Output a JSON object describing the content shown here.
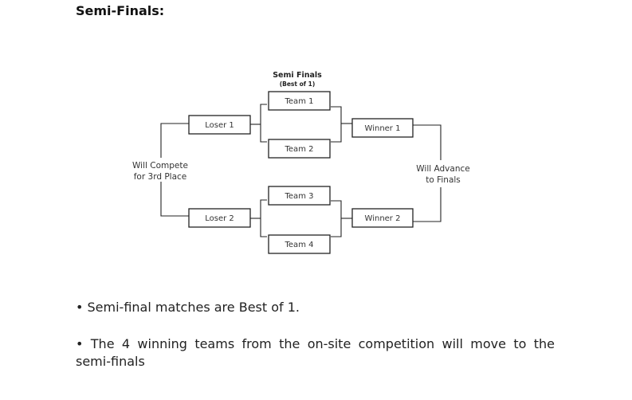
{
  "section": {
    "heading": "Semi-Finals:"
  },
  "bracket": {
    "title": "Semi Finals",
    "subtitle": "(Best of 1)",
    "teams": [
      "Team 1",
      "Team 2",
      "Team 3",
      "Team 4"
    ],
    "losers": [
      "Loser 1",
      "Loser 2"
    ],
    "winners": [
      "Winner 1",
      "Winner 2"
    ],
    "left_note": [
      "Will Compete",
      "for 3rd Place"
    ],
    "right_note": [
      "Will Advance",
      "to Finals"
    ]
  },
  "notes": {
    "bullet_1": "• Semi-final matches are Best of 1.",
    "bullet_2_line_1": "• The 4 winning teams from the on-site competition will move to the",
    "bullet_2_line_2": "semi-finals"
  }
}
